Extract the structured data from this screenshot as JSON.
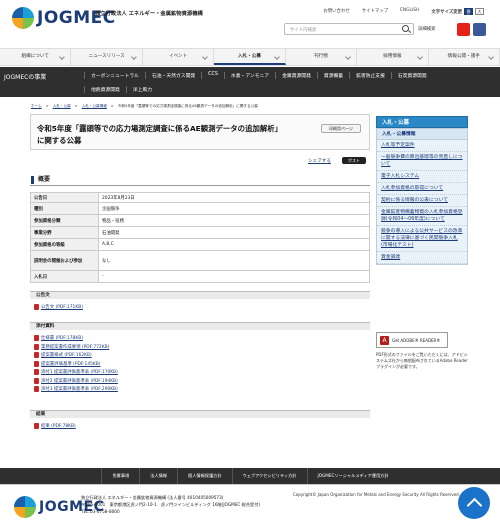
{
  "header": {
    "logo_text": "JOGMEC",
    "org_name": "独立行政法人 エネルギー・金属鉱物資源機構",
    "links": [
      "お問い合わせ",
      "サイトマップ",
      "ENGLISH"
    ],
    "font_size_label": "文字サイズ変更",
    "font_sizes": [
      "標準",
      "大"
    ],
    "search_placeholder": "サイト内検索",
    "detail_search": "詳細検索",
    "sns": [
      {
        "name": "youtube-icon",
        "color": "#e62117"
      },
      {
        "name": "facebook-icon",
        "color": "#3b5998"
      }
    ]
  },
  "gnav": [
    "組織について",
    "ニュースリリース",
    "イベント",
    "入札・公募",
    "刊行物",
    "採用情報",
    "情報公開・諸手"
  ],
  "subnav": {
    "title": "JOGMECの事業",
    "row1": [
      "カーボンニュートラル",
      "石油・天然ガス開発",
      "CCS",
      "水素・アンモニア",
      "金属資源開発",
      "資源備蓄",
      "鉱害防止支援",
      "石炭資源開発"
    ],
    "row2": [
      "地熱資源開発",
      "洋上風力"
    ]
  },
  "breadcrumb": [
    "ホーム",
    "入札・公募",
    "入札・公募情報",
    "令和5年度「露頭等での応力場測定調査に係るAE観測データの追加解析」に関する公募"
  ],
  "page": {
    "title": "令和5年度「露頭等での応力場測定調査に係るAE観測データの追加解析」に関する公募",
    "print_label": "印刷用ページ",
    "share_label": "シェアする",
    "post_label": "ポスト"
  },
  "overview": {
    "heading": "概要",
    "rows": [
      {
        "label": "公告日",
        "value": "2023年8月23日"
      },
      {
        "label": "種別",
        "value": "企画競争"
      },
      {
        "label": "参加資格分類",
        "value": "物品・役務"
      },
      {
        "label": "事業分野",
        "value": "石油開発"
      },
      {
        "label": "参加資格の等級",
        "value": "A,B,C"
      },
      {
        "label": "説明会の開催および参加",
        "value": "なし"
      },
      {
        "label": "入札日",
        "value": "-"
      }
    ]
  },
  "sections": [
    {
      "heading": "公告文",
      "files": [
        "公告文 (PDF:171KB)"
      ]
    },
    {
      "heading": "添付資料",
      "files": [
        "仕様書 (PDF:178KB)",
        "業務提案書作成要領 (PDF:772KB)",
        "提案書様式 (PDF:162KB)",
        "提案書評価基準 (PDF:145KB)",
        "添付1 提案書評価基準表 (PDF:170KB)",
        "添付2 提案書評価基準表 (PDF:194KB)",
        "添付3 提案書評価基準表 (PDF:290KB)"
      ]
    },
    {
      "heading": "結果",
      "files": [
        "結果 (PDF:78KB)"
      ]
    }
  ],
  "side": {
    "head": "入札・公募",
    "sub": "入札・公募情報",
    "items": [
      "入札等予定案件",
      "一般競争費の算出基礎等の見直しについて",
      "電子入札システム",
      "入札参加資格の取得について",
      "契約に係る情報の公表について",
      "金属鉱産物備蓄物資の入札参加資格登録(令和04〜06年度)について",
      "競争の導入による公共サービスの改革に関する法律に基づく民間競争入札(市場化テスト)",
      "資金調達"
    ]
  },
  "adobe": {
    "label": "Get ADOBE® READER®",
    "note": "PDF形式のファイルをご覧いただくには、アドビシステムズ社から無償配布されているAdobe Readerプラグインが必要です。"
  },
  "footnav": [
    "免責事項",
    "法人情報",
    "個人情報保護方針",
    "ウェブアクセシビリティ方針",
    "JOGMECソーシャルメディア運用方針"
  ],
  "footer": {
    "org_line": "独立行政法人 エネルギー・金属鉱物資源機構 (法人番号 4010405009573)",
    "address": "〒105-0001　東京都港区虎ノ門2-10-1　虎ノ門ツインビルディング 16階(JOGMEC 総合受付)",
    "tel": "TEL:03-6758-8000",
    "copyright": "Copyright© Japan Organization for Metals and Energy Security All Rights Reserved."
  }
}
